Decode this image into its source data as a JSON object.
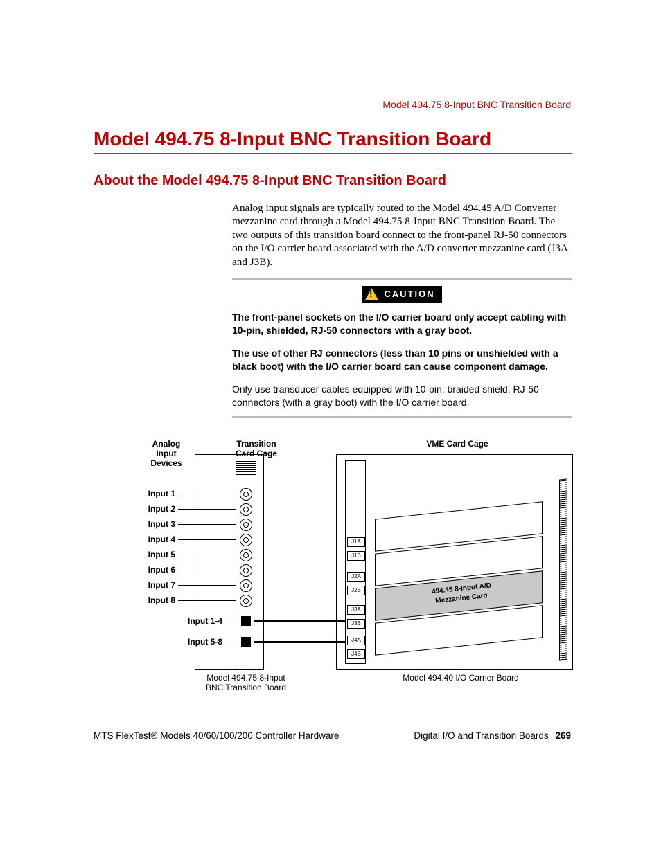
{
  "running_head": "Model 494.75 8-Input BNC Transition Board",
  "h1": "Model 494.75 8-Input BNC Transition Board",
  "h2": "About the Model 494.75 8-Input BNC Transition Board",
  "intro": "Analog input signals are typically routed to the Model 494.45 A/D Converter mezzanine card through a Model 494.75 8-Input BNC Transition Board. The two outputs of this transition board connect to the front-panel RJ-50 connectors on the I/O carrier board associated with the A/D converter mezzanine card (J3A and J3B).",
  "caution_label": "CAUTION",
  "caution_para1": "The front-panel sockets on the I/O carrier board only accept cabling with 10-pin, shielded, RJ-50 connectors with a gray boot.",
  "caution_para2": "The use of other RJ connectors (less than 10 pins or unshielded with a black boot) with the I/O carrier board can cause component damage.",
  "post_caution": "Only use transducer cables equipped with 10-pin, braided shield, RJ-50 connectors (with a gray boot) with the I/O carrier board.",
  "diagram": {
    "analog_head": "Analog\nInput\nDevices",
    "trans_head": "Transition\nCard Cage",
    "vme_head": "VME Card Cage",
    "inputs": [
      "Input 1",
      "Input 2",
      "Input 3",
      "Input 4",
      "Input 5",
      "Input 6",
      "Input 7",
      "Input 8"
    ],
    "group14": "Input 1-4",
    "group58": "Input 5-8",
    "caption_left_1": "Model 494.75 8-Input",
    "caption_left_2": "BNC Transition Board",
    "caption_right": "Model 494.40 I/O Carrier Board",
    "mezz_line1": "494.45 8-Input A/D",
    "mezz_line2": "Mezzanine Card",
    "j_labels": [
      "J1A",
      "J1B",
      "J2A",
      "J2B",
      "J3A",
      "J3B",
      "J4A",
      "J4B"
    ]
  },
  "footer": {
    "left": "MTS FlexTest® Models 40/60/100/200 Controller Hardware",
    "right_text": "Digital I/O and Transition Boards",
    "page_no": "269"
  }
}
